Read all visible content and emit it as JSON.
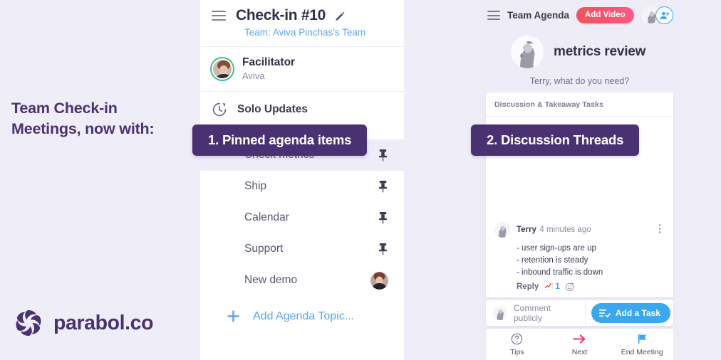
{
  "promo": {
    "headline_line1": "Team Check-in",
    "headline_line2": "Meetings, now with:",
    "brand": "parabol.co",
    "brand_color": "#493272",
    "logo_icon": "parabol-pinwheel-logo"
  },
  "callouts": [
    {
      "label": "1. Pinned agenda items",
      "color": "#4a3172"
    },
    {
      "label": "2. Discussion Threads",
      "color": "#4a3172"
    }
  ],
  "center_panel": {
    "menu_icon": "hamburger-menu-icon",
    "title": "Check-in #10",
    "edit_icon": "pencil-icon",
    "subtitle": "Team: Aviva Pinchas's Team",
    "subtitle_color": "#59a4f0",
    "facilitator": {
      "label": "Facilitator",
      "name": "Aviva",
      "avatar_icon": "facilitator-avatar",
      "avatar_ring_color": "#3dbb8e"
    },
    "solo_updates": {
      "label": "Solo Updates",
      "icon": "timer-history-icon"
    },
    "agenda_items": [
      {
        "label": "Check metrics",
        "trailing": "pin",
        "trailing_icon": "pin-icon",
        "active": true
      },
      {
        "label": "Ship",
        "trailing": "pin",
        "trailing_icon": "pin-icon",
        "active": false
      },
      {
        "label": "Calendar",
        "trailing": "pin",
        "trailing_icon": "pin-icon",
        "active": false
      },
      {
        "label": "Support",
        "trailing": "pin",
        "trailing_icon": "pin-icon",
        "active": false
      },
      {
        "label": "New demo",
        "trailing": "avatar",
        "trailing_icon": "member-avatar",
        "active": false
      }
    ],
    "add_topic": {
      "label": "Add Agenda Topic...",
      "icon": "plus-icon",
      "color": "#59a4f0"
    }
  },
  "right_panel": {
    "menu_icon": "hamburger-menu-icon",
    "title": "Team Agenda",
    "add_video_label": "Add Video",
    "add_video_color": "#f8546f",
    "header_avatar_icon": "bust-statue-avatar",
    "add_person_icon": "add-person-icon",
    "add_person_color": "#3ba7ef",
    "topic": {
      "avatar_icon": "bust-statue-avatar",
      "title": "metrics review",
      "prompt": "Terry, what do you need?"
    },
    "discussion": {
      "header": "Discussion & Takeaway Tasks",
      "comment": {
        "avatar_icon": "bust-statue-avatar",
        "author": "Terry",
        "timestamp": "4 minutes ago",
        "overflow_icon": "kebab-menu-icon",
        "lines": [
          "- user sign-ups are up",
          "- retention is steady",
          "- inbound traffic is down"
        ],
        "reply_label": "Reply",
        "reaction_emoji": "chart-increasing",
        "reaction_count": "1",
        "reaction_count_color": "#3ba7ef",
        "add_reaction_icon": "add-reaction-smiley-icon"
      }
    },
    "comment_bar": {
      "avatar_icon": "bust-statue-avatar",
      "placeholder": "Comment publicly",
      "add_task_label": "Add a Task",
      "add_task_icon": "task-list-check-icon",
      "add_task_color": "#3ba7ef"
    },
    "bottom_nav": [
      {
        "label": "Tips",
        "icon": "question-circle-icon",
        "color": "#6f6e88"
      },
      {
        "label": "Next",
        "icon": "arrow-right-icon",
        "color": "#f5355f"
      },
      {
        "label": "End Meeting",
        "icon": "flag-icon",
        "color": "#3ba7ef"
      }
    ]
  }
}
